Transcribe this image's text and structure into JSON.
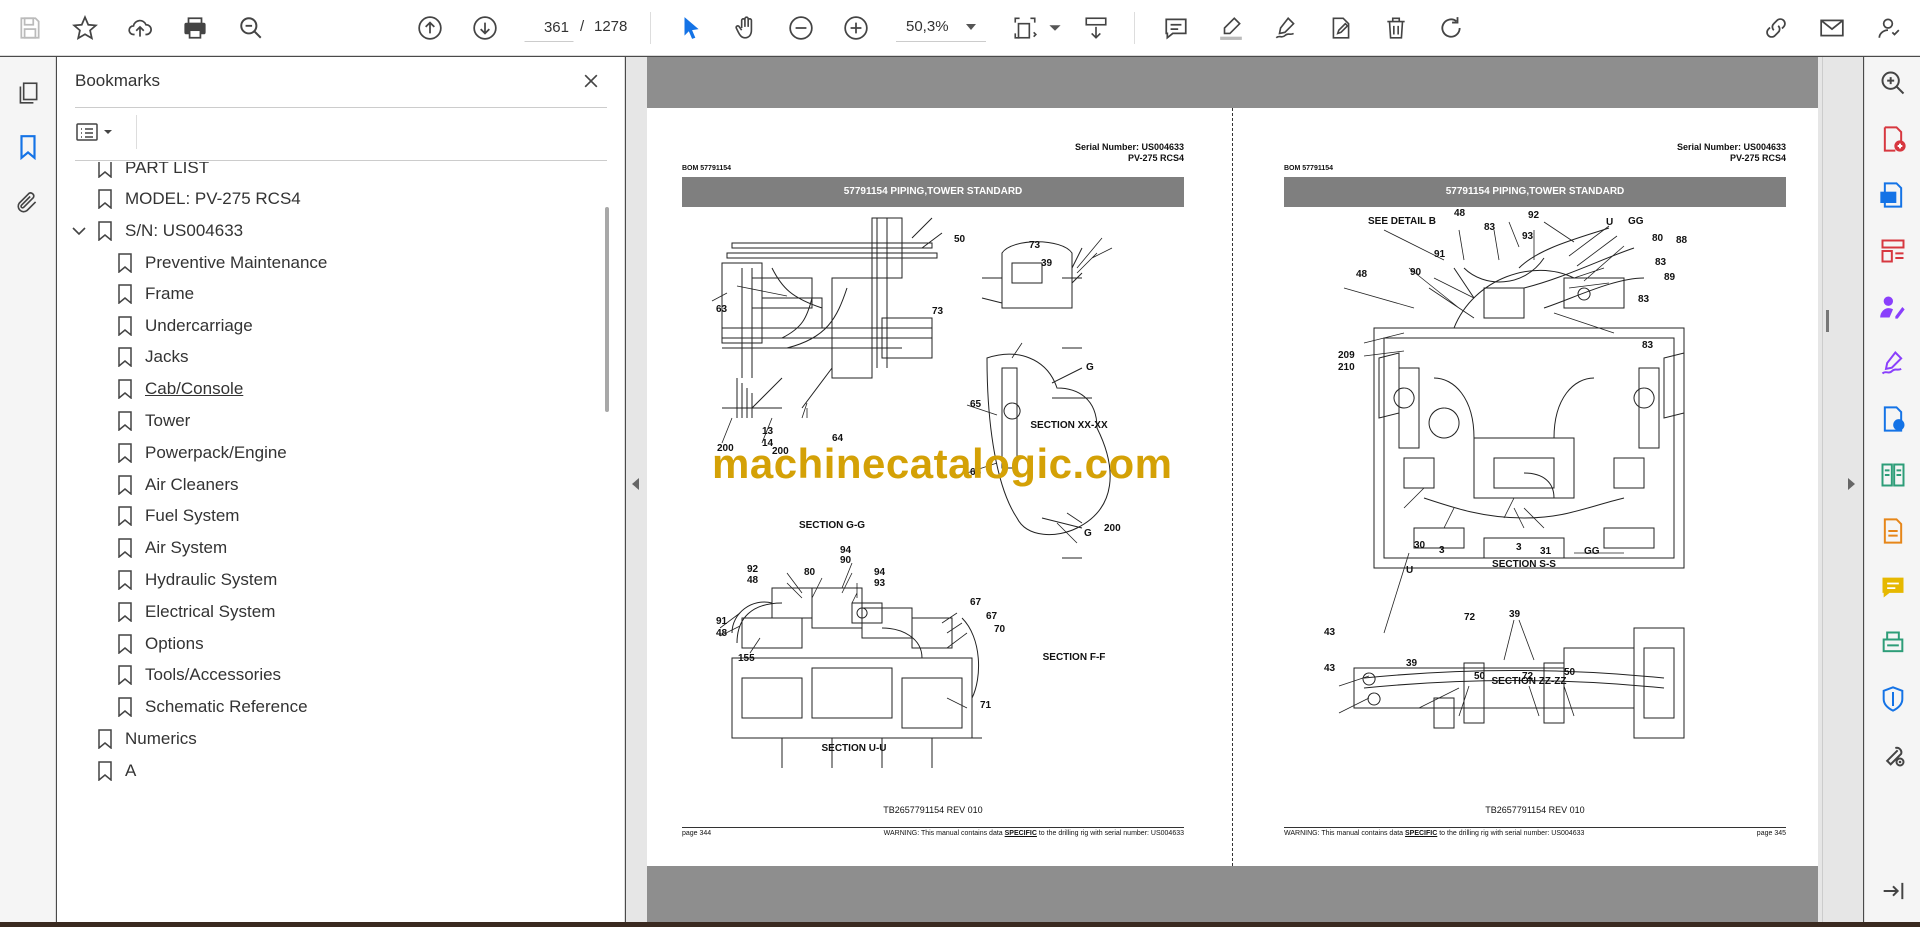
{
  "toolbar": {
    "page_current": "361",
    "page_separator": "/",
    "page_total": "1278",
    "zoom": "50,3%",
    "icons": [
      "save-icon",
      "star-icon",
      "upload-icon",
      "print-icon",
      "zoom-search-icon",
      "prev-page-icon",
      "next-page-icon",
      "select-arrow-icon",
      "hand-icon",
      "zoom-out-icon",
      "zoom-in-icon",
      "fit-page-icon",
      "scroll-mode-icon",
      "comment-icon",
      "highlight-icon",
      "sign-icon",
      "edit-icon",
      "delete-icon",
      "rotate-icon",
      "share-link-icon",
      "email-icon",
      "account-icon"
    ]
  },
  "bookmarks": {
    "title": "Bookmarks",
    "items": [
      {
        "label": "PART LIST",
        "level": 1
      },
      {
        "label": "MODEL: PV-275 RCS4",
        "level": 1
      },
      {
        "label": "S/N: US004633",
        "level": 1,
        "expanded": true
      },
      {
        "label": "Preventive Maintenance",
        "level": 2
      },
      {
        "label": "Frame",
        "level": 2
      },
      {
        "label": "Undercarriage",
        "level": 2
      },
      {
        "label": "Jacks",
        "level": 2
      },
      {
        "label": "Cab/Console",
        "level": 2,
        "underlined": true
      },
      {
        "label": "Tower",
        "level": 2
      },
      {
        "label": "Powerpack/Engine",
        "level": 2
      },
      {
        "label": "Air Cleaners",
        "level": 2
      },
      {
        "label": "Fuel System",
        "level": 2
      },
      {
        "label": "Air System",
        "level": 2
      },
      {
        "label": "Hydraulic System",
        "level": 2
      },
      {
        "label": "Electrical System",
        "level": 2
      },
      {
        "label": "Options",
        "level": 2
      },
      {
        "label": "Tools/Accessories",
        "level": 2
      },
      {
        "label": "Schematic Reference",
        "level": 2
      },
      {
        "label": "Numerics",
        "level": 1
      },
      {
        "label": "A",
        "level": 1
      }
    ]
  },
  "document": {
    "left_page": {
      "serial_number": "Serial Number: US004633",
      "model": "PV-275 RCS4",
      "bom": "BOM 57791154",
      "title": "57791154 PIPING,TOWER STANDARD",
      "ref": "TB2657791154 REV 010",
      "page_label": "page 344",
      "warning_pre": "WARNING:  This manual contains data ",
      "warning_bold": "SPECIFIC",
      "warning_post": " to the drilling rig with serial number: US004633",
      "sections": [
        "SECTION G-G",
        "SECTION XX-XX",
        "SECTION F-F",
        "SECTION U-U"
      ],
      "callouts": [
        "50",
        "73",
        "39",
        "73",
        "63",
        "64",
        "13",
        "14",
        "200",
        "200",
        "65",
        "65",
        "G",
        "G",
        "200",
        "94",
        "90",
        "92",
        "48",
        "80",
        "94",
        "93",
        "91",
        "48",
        "155",
        "67",
        "67",
        "70",
        "71"
      ]
    },
    "right_page": {
      "serial_number": "Serial Number: US004633",
      "model": "PV-275 RCS4",
      "bom": "BOM 57791154",
      "title": "57791154 PIPING,TOWER STANDARD",
      "ref": "TB2657791154 REV 010",
      "page_label": "page 345",
      "warning_pre": "WARNING:  This manual contains data ",
      "warning_bold": "SPECIFIC",
      "warning_post": " to the drilling rig with serial number: US004633",
      "sections": [
        "SECTION S-S",
        "SECTION ZZ-ZZ"
      ],
      "detail": "SEE DETAIL B",
      "callouts": [
        "48",
        "92",
        "83",
        "93",
        "U",
        "GG",
        "80",
        "88",
        "91",
        "83",
        "48",
        "90",
        "83",
        "89",
        "83",
        "83",
        "209",
        "210",
        "30",
        "3",
        "3",
        "31",
        "U",
        "GG",
        "72",
        "39",
        "43",
        "43",
        "39",
        "50",
        "72",
        "50"
      ]
    }
  },
  "watermark": "machinecatalogic.com",
  "right_rail_icons": [
    "search-zoom-icon",
    "add-pdf-icon",
    "export-pdf-icon",
    "organize-icon",
    "fill-sign-icon",
    "request-sign-icon",
    "send-icon",
    "compare-icon",
    "combine-icon",
    "comment-icon",
    "scan-icon",
    "protect-icon",
    "tools-icon",
    "collapse-icon"
  ],
  "colors": {
    "watermark": "#d4a106",
    "band": "#7f7f7f",
    "accent_blue": "#1473e6",
    "accent_pink": "#d7373f",
    "accent_purple": "#8a3ffc"
  }
}
